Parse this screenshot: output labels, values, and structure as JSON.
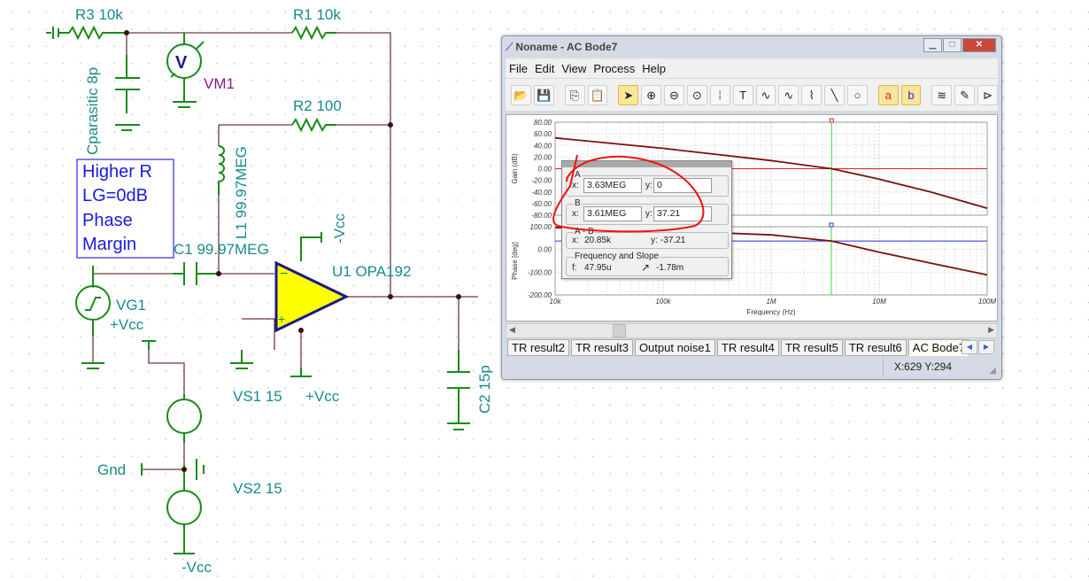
{
  "schematic": {
    "r3": "R3 10k",
    "r1": "R1 10k",
    "r2": "R2 100",
    "cpar": "Cparasitic 8p",
    "vm1": "VM1",
    "vm_symbol": "V",
    "l1": "L1 99.97MEG",
    "c1": "C1 99.97MEG",
    "minus_vcc_top": "-Vcc",
    "u1": "U1 OPA192",
    "vg1": "VG1",
    "plus_vcc_left": "+Vcc",
    "vs1": "VS1 15",
    "plus_vcc_bottom": "+Vcc",
    "c2": "C2 15p",
    "gnd": "Gnd",
    "vs2": "VS2 15",
    "minus_vcc_bottom": "-Vcc",
    "note": [
      "Higher R",
      "LG=0dB",
      "Phase",
      "Margin"
    ]
  },
  "window": {
    "title": "Noname - AC Bode7",
    "menu": [
      "File",
      "Edit",
      "View",
      "Process",
      "Help"
    ],
    "toolbar": [
      [
        "open-icon",
        "📂"
      ],
      [
        "save-icon",
        "💾"
      ],
      [
        "sep",
        ""
      ],
      [
        "copy-icon",
        "⎘"
      ],
      [
        "paste-icon",
        "📋"
      ],
      [
        "sep",
        ""
      ],
      [
        "pointer-icon",
        "➤"
      ],
      [
        "zoom-in-icon",
        "⊕"
      ],
      [
        "zoom-out-icon",
        "⊖"
      ],
      [
        "zoom-100-icon",
        "⊙"
      ],
      [
        "grid-icon",
        "⁞"
      ],
      [
        "text-icon",
        "T"
      ],
      [
        "curve-icon",
        "∿"
      ],
      [
        "curve2-icon",
        "∿"
      ],
      [
        "axis-icon",
        "⌇"
      ],
      [
        "line-icon",
        "╲"
      ],
      [
        "circle-icon",
        "○"
      ],
      [
        "sep",
        ""
      ],
      [
        "cursor-a-icon",
        "a"
      ],
      [
        "cursor-b-icon",
        "b"
      ],
      [
        "sep",
        ""
      ],
      [
        "add-curve-icon",
        "≋"
      ],
      [
        "picker-icon",
        "✎"
      ],
      [
        "flag-icon",
        "⊳"
      ]
    ],
    "tabs": [
      "TR result2",
      "TR result3",
      "Output noise1",
      "TR result4",
      "TR result5",
      "TR result6",
      "AC Bode7"
    ],
    "active_tab": "AC Bode7",
    "status": "X:629  Y:294"
  },
  "cursor_dialog": {
    "a_label": "A",
    "a_x": "3.63MEG",
    "a_y": "0",
    "b_label": "B",
    "b_x": "3.61MEG",
    "b_y": "37.21",
    "ab_label": "A - B",
    "ab_x": "20.85k",
    "ab_y": "-37.21",
    "fs_label": "Frequency and Slope",
    "f": "47.95u",
    "slope": "-1.78m",
    "x_label": "x:",
    "y_label": "y:",
    "f_label": "f:"
  },
  "chart_data": [
    {
      "type": "line",
      "ylabel": "Gain (dB)",
      "xscale": "log",
      "xlim": [
        10000,
        100000000
      ],
      "ylim": [
        -80,
        80
      ],
      "yticks": [
        "80.00",
        "60.00",
        "40.00",
        "20.00",
        "0.00",
        "-20.00",
        "-40.00",
        "-60.00",
        "-80.00"
      ],
      "x": [
        10000,
        100000,
        1000000,
        3630000,
        10000000,
        30000000,
        100000000
      ],
      "y": [
        53,
        35,
        14,
        0,
        -18,
        -40,
        -68
      ],
      "curve_color": "#7a1010",
      "marker_line": {
        "y": 0,
        "color": "#e02020"
      },
      "cursor_x": 3630000,
      "grid": true
    },
    {
      "type": "line",
      "ylabel": "Phase [deg]",
      "xlabel": "Frequency (Hz)",
      "xscale": "log",
      "xlim": [
        10000,
        100000000
      ],
      "ylim": [
        -200,
        100
      ],
      "yticks": [
        "100.00",
        "0.00",
        "-100.00",
        "-200.00"
      ],
      "xticks": [
        "10k",
        "100k",
        "1M",
        "10M",
        "100M"
      ],
      "x": [
        10000,
        100000,
        1000000,
        3610000,
        10000000,
        30000000,
        100000000
      ],
      "y": [
        96,
        83,
        64,
        37.21,
        -12,
        -60,
        -112
      ],
      "curve_color": "#7a1010",
      "marker_line": {
        "y": 37.21,
        "color": "#2030e0"
      },
      "cursor_x": 3610000,
      "grid": true
    }
  ]
}
